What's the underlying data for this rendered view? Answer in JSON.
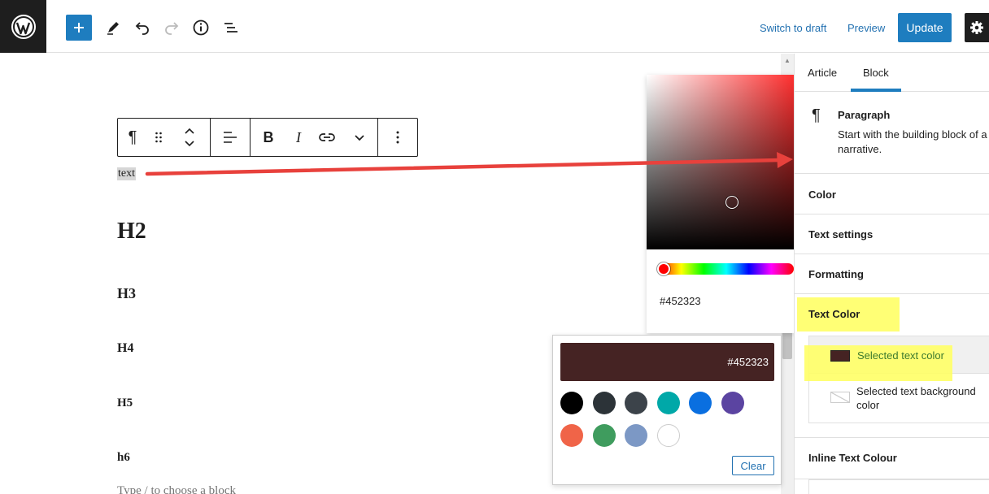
{
  "topbar": {
    "switch_to_draft": "Switch to draft",
    "preview": "Preview",
    "update": "Update"
  },
  "toolbar": {
    "paragraph_icon": "¶",
    "bold": "B",
    "italic": "I"
  },
  "content": {
    "selected_text": "text",
    "h2": "H2",
    "h3": "H3",
    "h4": "H4",
    "h5": "H5",
    "h6": "h6",
    "placeholder": "Type / to choose a block"
  },
  "picker": {
    "hex": "#452323"
  },
  "palette": {
    "hex": "#452323",
    "current_color": "#452323",
    "swatches": [
      "#000000",
      "#2c3338",
      "#3c434a",
      "#00a8a8",
      "#0a6fe0",
      "#5b44a1",
      "#f06448",
      "#3f9c5e",
      "#7c98c5",
      "#ffffff"
    ],
    "clear": "Clear"
  },
  "sidebar": {
    "tabs": {
      "article": "Article",
      "block": "Block"
    },
    "block_card": {
      "icon": "¶",
      "title": "Paragraph",
      "desc_line1": "Start with the building block of a",
      "desc_line2": "narrative."
    },
    "panels": {
      "color": "Color",
      "text_settings": "Text settings",
      "formatting": "Formatting",
      "text_color": "Text Color",
      "inline_text_colour": "Inline Text Colour"
    },
    "options": {
      "selected_text_color": "Selected text color",
      "selected_bg_line1": "Selected text background",
      "selected_bg_line2": "color"
    }
  },
  "colors": {
    "accent": "#1e7dbf",
    "highlight": "#ffff66",
    "arrow": "#e8413c"
  }
}
